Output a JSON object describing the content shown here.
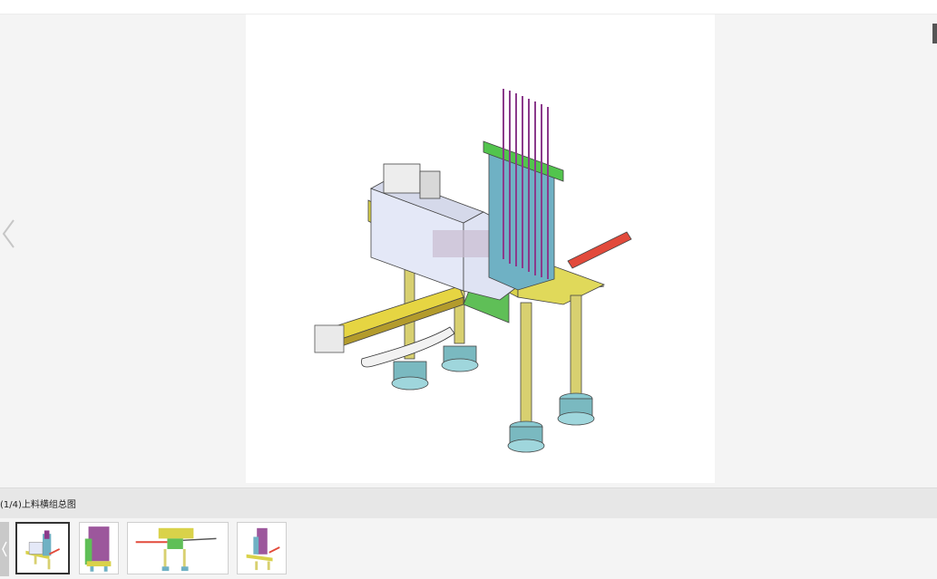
{
  "viewer": {
    "caption": "(1/4)上料横组总图",
    "main_image_icon": "cad-assembly-drawing",
    "prev_icon": "chevron-left-icon"
  },
  "thumbnails": [
    {
      "icon": "cad-assembly-thumbnail",
      "active": true
    },
    {
      "icon": "cad-side-view-thumbnail",
      "active": false
    },
    {
      "icon": "cad-front-view-thumbnail",
      "active": false
    },
    {
      "icon": "cad-iso-view-thumbnail",
      "active": false
    }
  ],
  "colors": {
    "background": "#f4f4f4",
    "caption_bar": "#e7e7e7",
    "active_border": "#333333"
  }
}
